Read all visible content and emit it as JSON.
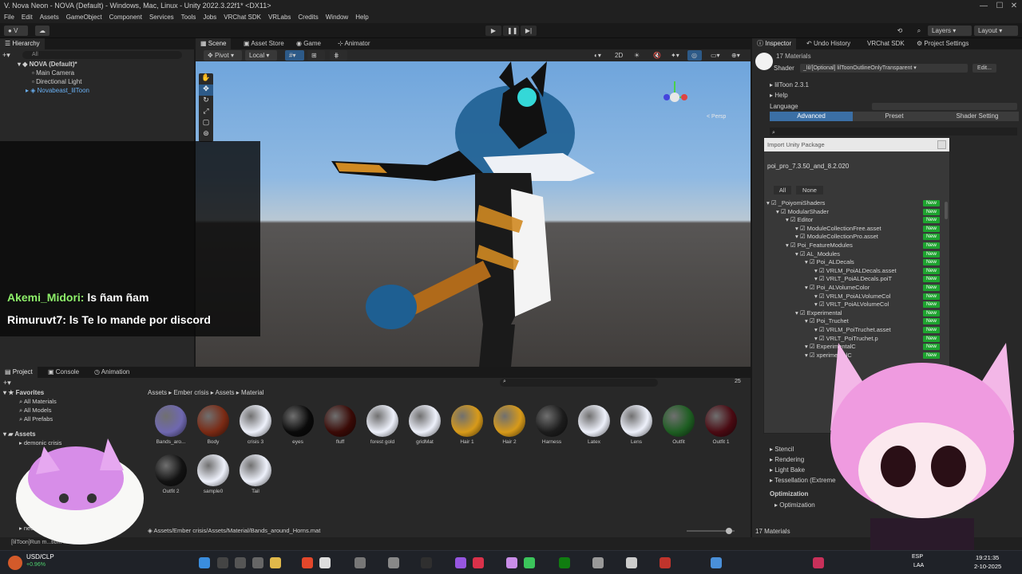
{
  "window": {
    "title": "V. Nova Neon - NOVA (Default) - Windows, Mac, Linux - Unity 2022.3.22f1* <DX11>",
    "controls": [
      "—",
      "☐",
      "✕"
    ]
  },
  "menu": [
    "File",
    "Edit",
    "Assets",
    "GameObject",
    "Component",
    "Services",
    "Tools",
    "Jobs",
    "VRChat SDK",
    "VRLabs",
    "Credits",
    "Window",
    "Help"
  ],
  "toolbar": {
    "account": "V",
    "layers": "Layers",
    "layout": "Layout"
  },
  "hierarchy": {
    "tab": "Hierarchy",
    "search_placeholder": "All",
    "items": [
      "NOVA (Default)*",
      "Main Camera",
      "Directional Light",
      "Novabeast_lilToon"
    ]
  },
  "scene": {
    "tabs": [
      "Scene",
      "Asset Store",
      "Game",
      "Animator"
    ],
    "pivot": "Pivot",
    "local": "Local",
    "mode_2d": "2D",
    "persp": "< Persp"
  },
  "chat": {
    "messages": [
      {
        "user": "Akemi_Midori:",
        "text": "ls ñam ñam",
        "color": "#8ef06a"
      },
      {
        "user": "Rimuruvt7:",
        "text": "ls Te lo mande por discord",
        "color": "#ffffff"
      }
    ]
  },
  "inspector": {
    "tabs": [
      "Inspector",
      "Undo History",
      "VRChat SDK",
      "Project Settings"
    ],
    "materials_count": "17 Materials",
    "shader_label": "Shader",
    "shader_value": "_lil/[Optional] lilToonOutlineOnlyTransparent",
    "edit": "Edit...",
    "liltoon_version": "lilToon 2.3.1",
    "help": "Help",
    "language": "Language",
    "mode_buttons": [
      "Advanced",
      "Preset",
      "Shader Setting"
    ],
    "sections": [
      "Stencil",
      "Rendering",
      "Light Bake",
      "Tessellation (Extreme"
    ],
    "optimization_header": "Optimization",
    "optimization_item": "Optimization",
    "footer": "17 Materials"
  },
  "import_package": {
    "title": "Import Unity Package",
    "package_name": "poi_pro_7.3.50_and_8.2.020",
    "all": "All",
    "none": "None",
    "new_badge": "New",
    "rows": [
      {
        "label": "_PoiyomiShaders",
        "indent": 0
      },
      {
        "label": "ModularShader",
        "indent": 1
      },
      {
        "label": "Editor",
        "indent": 2
      },
      {
        "label": "ModuleCollectionFree.asset",
        "indent": 3
      },
      {
        "label": "ModuleCollectionPro.asset",
        "indent": 3
      },
      {
        "label": "Poi_FeatureModules",
        "indent": 2
      },
      {
        "label": "AL_Modules",
        "indent": 3
      },
      {
        "label": "Poi_ALDecals",
        "indent": 4
      },
      {
        "label": "VRLM_PoiALDecals.asset",
        "indent": 5
      },
      {
        "label": "VRLT_PoiALDecals.poiT",
        "indent": 5
      },
      {
        "label": "Poi_ALVolumeColor",
        "indent": 4
      },
      {
        "label": "VRLM_PoiALVolumeCol",
        "indent": 5
      },
      {
        "label": "VRLT_PoiALVolumeCol",
        "indent": 5
      },
      {
        "label": "Experimental",
        "indent": 3
      },
      {
        "label": "Poi_Truchet",
        "indent": 4
      },
      {
        "label": "VRLM_PoiTruchet.asset",
        "indent": 5
      },
      {
        "label": "VRLT_PoiTruchet.p",
        "indent": 5
      },
      {
        "label": "ExperimentalC",
        "indent": 4
      },
      {
        "label": "xperimentalC",
        "indent": 4
      }
    ]
  },
  "project": {
    "tabs": [
      "Project",
      "Console",
      "Animation"
    ],
    "favorites": "Favorites",
    "fav_items": [
      "All Materials",
      "All Models",
      "All Prefabs"
    ],
    "assets_root": "Assets",
    "tree_items": [
      "demonic crisis",
      "neon cr"
    ],
    "breadcrumb": [
      "Assets",
      "Ember crisis",
      "Assets",
      "Material"
    ],
    "item_count": "25",
    "path": "Assets/Ember crisis/Assets/Material/Bands_around_Horns.mat",
    "console_line": "[lilToon]Run m...tion: ne",
    "assets": [
      {
        "label": "Bands_aro...",
        "color": "#6f68b0"
      },
      {
        "label": "Body",
        "color": "#7a2a14"
      },
      {
        "label": "crisis 3",
        "color": "#eef1fb"
      },
      {
        "label": "eyes",
        "color": "#0a0a0a"
      },
      {
        "label": "fluff",
        "color": "#3a0a06"
      },
      {
        "label": "forest gold",
        "color": "#eef1fb"
      },
      {
        "label": "gridMat",
        "color": "#eef1fb"
      },
      {
        "label": "Hair 1",
        "color": "#d79a1a"
      },
      {
        "label": "Hair 2",
        "color": "#d79a1a"
      },
      {
        "label": "Harness",
        "color": "#1c1c1c"
      },
      {
        "label": "Latex",
        "color": "#eef1fb"
      },
      {
        "label": "Lens",
        "color": "#eef1fb"
      },
      {
        "label": "Outfit",
        "color": "#1e5e22"
      },
      {
        "label": "Outfit 1",
        "color": "#4a0a12"
      },
      {
        "label": "Outfit 2",
        "color": "#121212"
      },
      {
        "label": "sample0",
        "color": "#eef1fb"
      },
      {
        "label": "Tail",
        "color": "#eef1fb"
      }
    ]
  },
  "taskbar": {
    "ticker": "USD/CLP",
    "ticker_change": "+0.96%",
    "lang": "ESP",
    "lang2": "LAA",
    "time": "19:21:35",
    "date": "2-10-2025"
  }
}
